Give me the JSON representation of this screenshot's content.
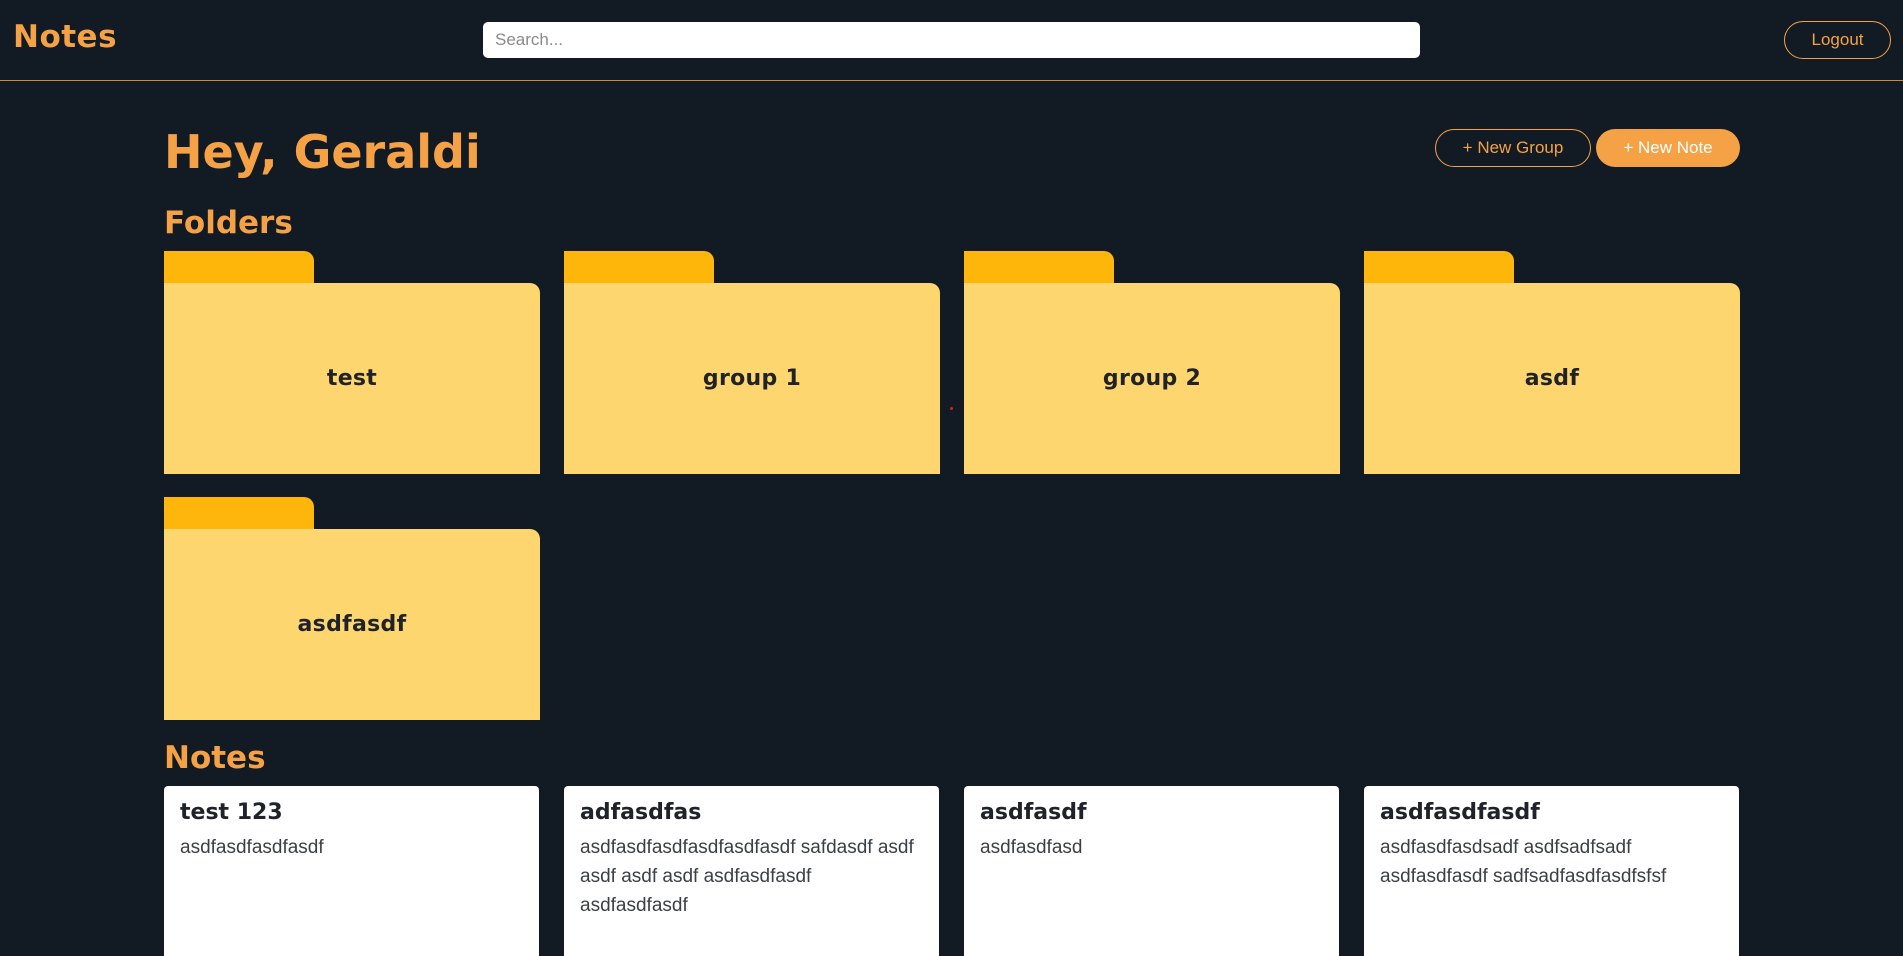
{
  "header": {
    "brand": "Notes",
    "search_placeholder": "Search...",
    "logout_label": "Logout"
  },
  "main": {
    "greeting": "Hey, Geraldi",
    "new_group_label": "+ New Group",
    "new_note_label": "+ New Note",
    "folders_title": "Folders",
    "notes_title": "Notes"
  },
  "folders": [
    {
      "label": "test"
    },
    {
      "label": "group 1"
    },
    {
      "label": "group 2"
    },
    {
      "label": "asdf"
    },
    {
      "label": "asdfasdf"
    }
  ],
  "notes": [
    {
      "title": "test 123",
      "body": "asdfasdfasdfasdf"
    },
    {
      "title": "adfasdfas",
      "body": "asdfasdfasdfasdfasdfasdf safdasdf asdf asdf asdf asdf asdfasdfasdf asdfasdfasdf"
    },
    {
      "title": "asdfasdf",
      "body": "asdfasdfasd"
    },
    {
      "title": "asdfasdfasdf",
      "body": "asdfasdfasdsadf asdfsadfsadf asdfasdfasdf sadfsadfasdfasdfsfsf"
    }
  ],
  "colors": {
    "background": "#121a24",
    "accent": "#f4a245",
    "folder_tab": "#ffb60a",
    "folder_body": "#fdd66f",
    "card": "#ffffff"
  }
}
